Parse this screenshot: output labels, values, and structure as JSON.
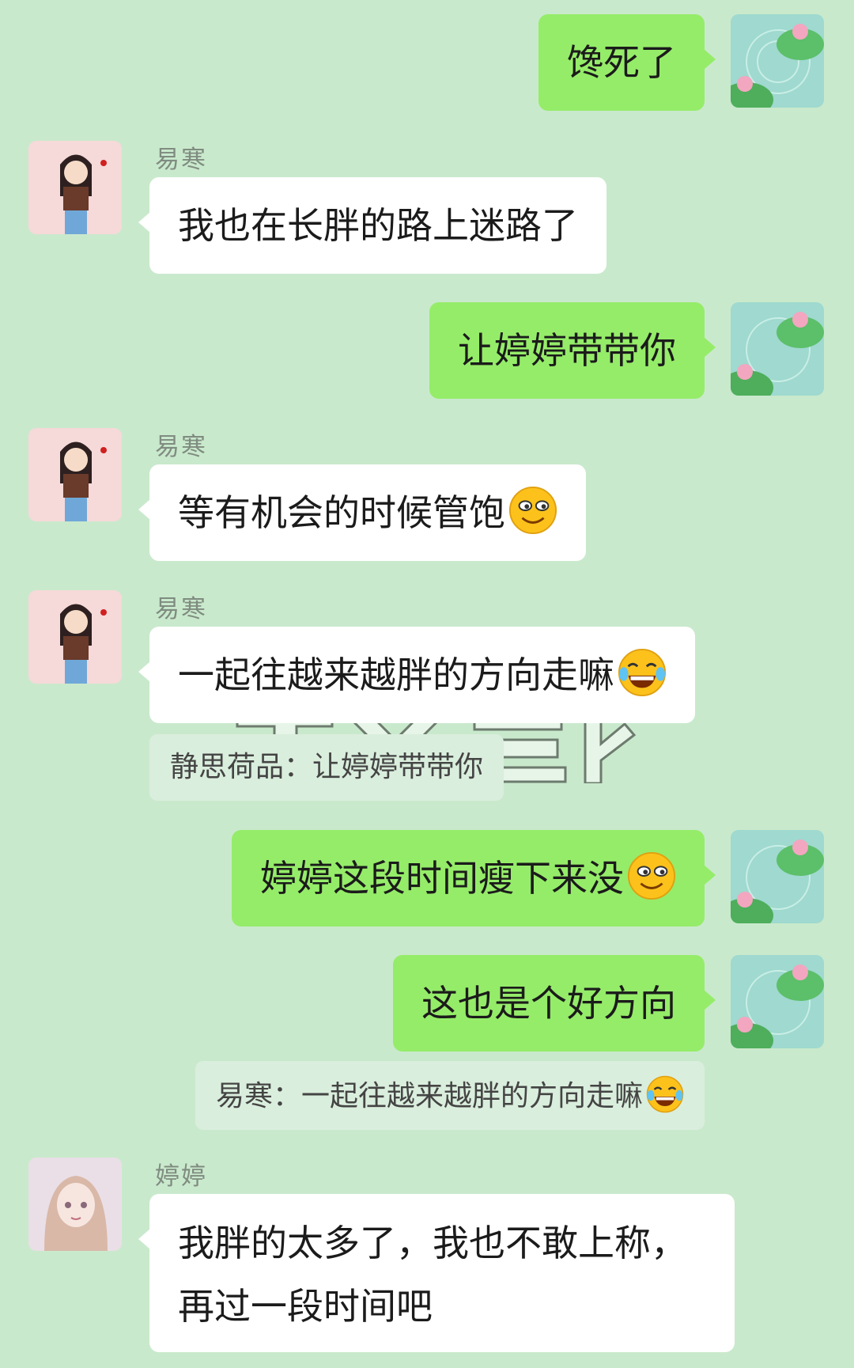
{
  "messages": [
    {
      "sender": "me",
      "text": "馋死了"
    },
    {
      "sender_name": "易寒",
      "text": "我也在长胖的路上迷路了"
    },
    {
      "sender": "me",
      "text": "让婷婷带带你"
    },
    {
      "sender_name": "易寒",
      "text": "等有机会的时候管饱",
      "emoji": "smirk-emoji"
    },
    {
      "sender_name": "易寒",
      "text": "一起往越来越胖的方向走嘛",
      "emoji": "laugh-tears-emoji",
      "quote": "静思荷品：让婷婷带带你"
    },
    {
      "sender": "me",
      "text": "婷婷这段时间瘦下来没",
      "emoji": "smirk-emoji"
    },
    {
      "sender": "me",
      "text": "这也是个好方向",
      "quote": "易寒：一起往越来越胖的方向走嘛"
    },
    {
      "sender_name": "婷婷",
      "text_line1": "我胖的太多了，我也不敢上称，",
      "text_line2": "再过一段时间吧"
    }
  ],
  "colors": {
    "background": "#c9e9cc",
    "my_bubble": "#95ec69",
    "their_bubble": "#ffffff",
    "quote_bg": "#daeedd",
    "name_text": "#7f8c80"
  }
}
